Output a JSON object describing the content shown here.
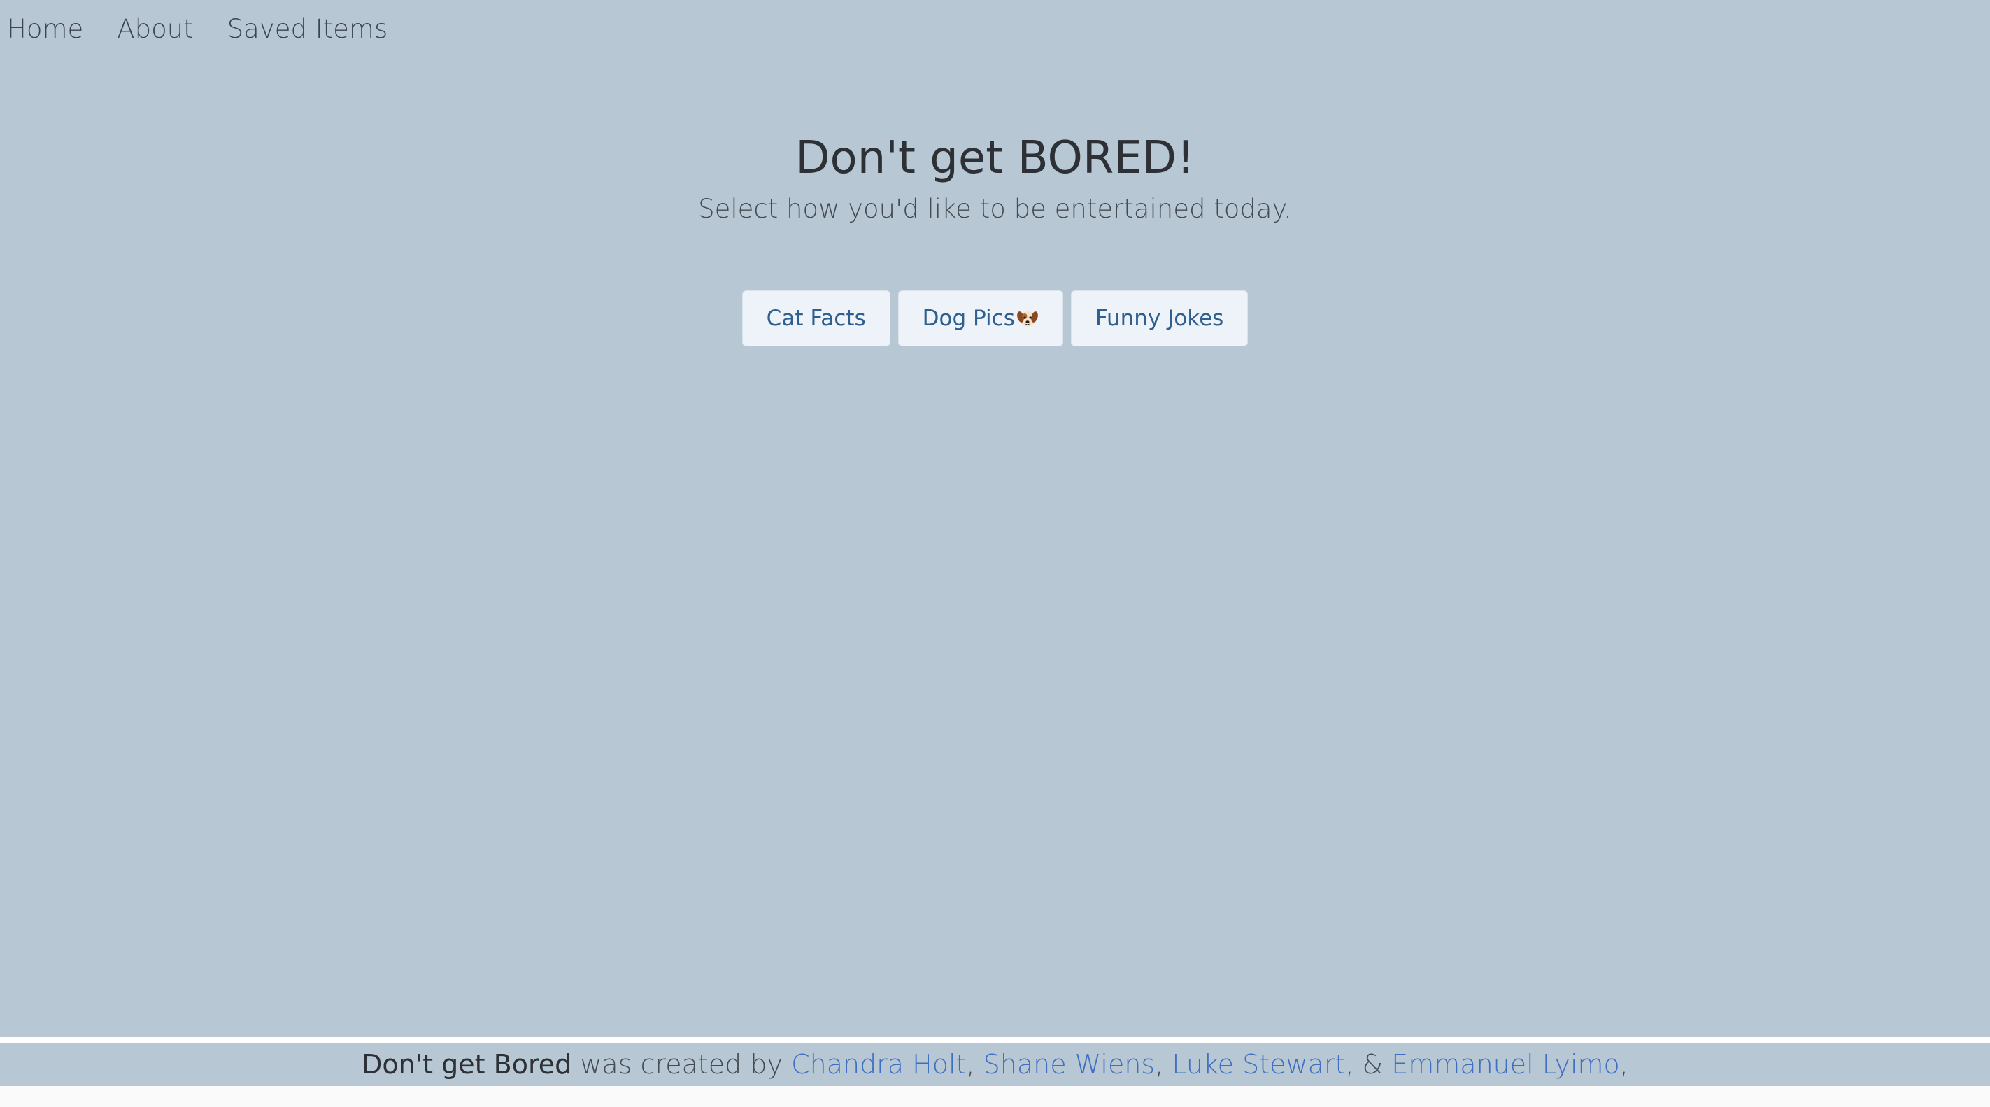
{
  "nav": {
    "items": [
      {
        "label": "Home"
      },
      {
        "label": "About"
      },
      {
        "label": "Saved Items"
      }
    ]
  },
  "hero": {
    "title": "Don't get BORED!",
    "subtitle": "Select how you'd like to be entertained today."
  },
  "choices": {
    "cat_label": "Cat Facts",
    "dog_label": "Dog Pics",
    "dog_icon": "dog-face-icon",
    "jokes_label": "Funny Jokes"
  },
  "footer": {
    "brand": "Don't get Bored",
    "text_created": " was created by ",
    "authors": [
      "Chandra Holt",
      "Shane Wiens",
      "Luke Stewart",
      "Emmanuel Lyimo"
    ],
    "separator": ", ",
    "last_separator": ", & ",
    "trailing": ","
  },
  "colors": {
    "background": "#b8c7d4",
    "button_bg": "#edf3f9",
    "button_text": "#2f5f8e",
    "link": "#3f6fc2"
  }
}
